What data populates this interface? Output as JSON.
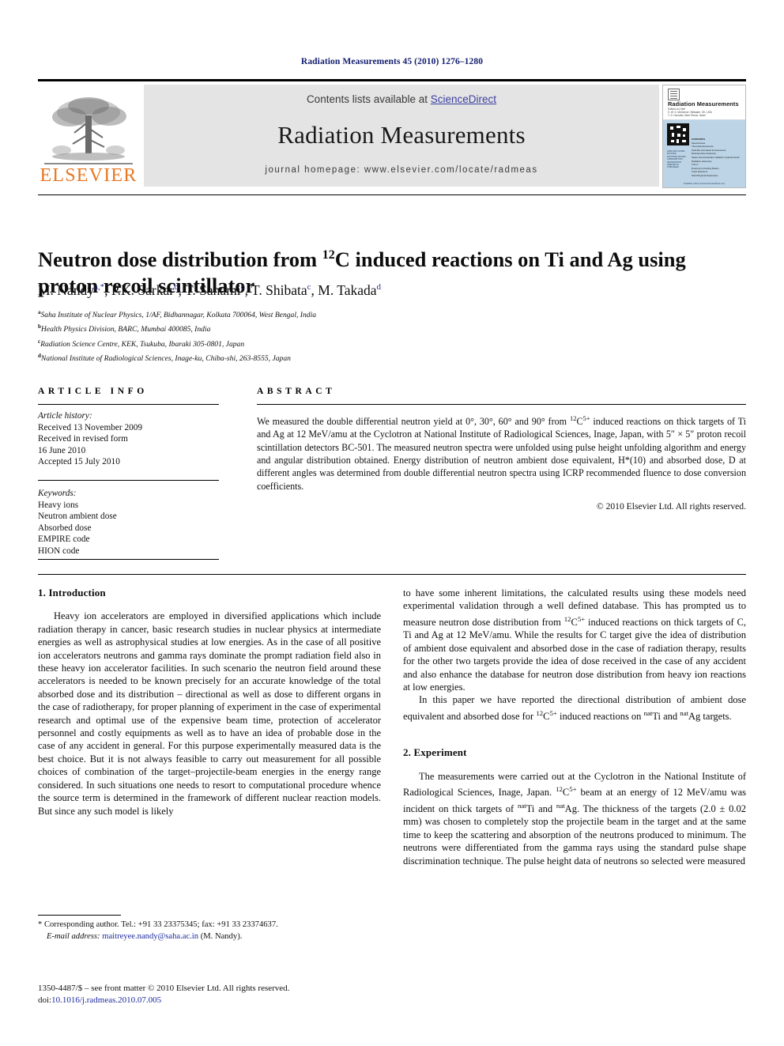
{
  "running_head": "Radiation Measurements 45 (2010) 1276–1280",
  "masthead": {
    "contents_prefix": "Contents lists available at ",
    "sciencedirect": "ScienceDirect",
    "journal_name": "Radiation Measurements",
    "homepage": "journal homepage: www.elsevier.com/locate/radmeas",
    "publisher_wordmark": "ELSEVIER",
    "sciencedirect_color": "#3b3fa0",
    "elsevier_orange": "#e87722",
    "band_color": "#e4e4e4"
  },
  "cover": {
    "title": "Radiation Measurements",
    "subtitle": "Editors-in-Chief\nS. W. S. McKeever, Stillwater, OK, USA\nY. S. Horowitz, Beer Sheva, Israel",
    "left_column": "AIMS AND SCOPE\nEDITORS\nEDITORIAL BOARD\nSUBSCRIPTION\nINFORMATION\nINDEXED IN\nPUBLISHER",
    "toc_heading": "CONTENTS",
    "toc_items": [
      "Special Issue",
      "Thermoluminescence",
      "Optically stimulated luminescence",
      "Retrospective dosimetry",
      "Space and accelerator radiation measurements",
      "Radiation dosimetry",
      "TLD in",
      "Dosimetry including Radon",
      "Track Detectors",
      "Solid Physical Dosimeters"
    ],
    "footer": "Available online at www.sciencedirect.com"
  },
  "article": {
    "title_part1": "Neutron dose distribution from ",
    "title_sup": "12",
    "title_part2": "C induced reactions on Ti and Ag using proton recoil scintillator",
    "authors": [
      {
        "name": "M. Nandy",
        "marks": "a,*"
      },
      {
        "name": "P.K. Sarkar",
        "marks": "b"
      },
      {
        "name": "T. Sanami",
        "marks": "c"
      },
      {
        "name": "T. Shibata",
        "marks": "c"
      },
      {
        "name": "M. Takada",
        "marks": "d"
      }
    ],
    "affiliations": [
      {
        "mark": "a",
        "text": "Saha Institute of Nuclear Physics, 1/AF, Bidhannagar, Kolkata 700064, West Bengal, India"
      },
      {
        "mark": "b",
        "text": "Health Physics Division, BARC, Mumbai 400085, India"
      },
      {
        "mark": "c",
        "text": "Radiation Science Centre, KEK, Tsukuba, Ibaraki 305-0801, Japan"
      },
      {
        "mark": "d",
        "text": "National Institute of Radiological Sciences, Inage-ku, Chiba-shi, 263-8555, Japan"
      }
    ]
  },
  "article_info": {
    "heading": "ARTICLE INFO",
    "history_label": "Article history:",
    "history_lines": [
      "Received 13 November 2009",
      "Received in revised form",
      "16 June 2010",
      "Accepted 15 July 2010"
    ],
    "keywords_label": "Keywords:",
    "keywords": [
      "Heavy ions",
      "Neutron ambient dose",
      "Absorbed dose",
      "EMPIRE code",
      "HION code"
    ]
  },
  "abstract": {
    "heading": "ABSTRACT",
    "text": "We measured the double differential neutron yield at 0°, 30°, 60° and 90° from 12C5+ induced reactions on thick targets of Ti and Ag at 12 MeV/amu at the Cyclotron at National Institute of Radiological Sciences, Inage, Japan, with 5″ × 5″ proton recoil scintillation detectors BC-501. The measured neutron spectra were unfolded using pulse height unfolding algorithm and energy and angular distribution obtained. Energy distribution of neutron ambient dose equivalent, H*(10) and absorbed dose, D at different angles was determined from double differential neutron spectra using ICRP recommended fluence to dose conversion coefficients.",
    "copyright": "© 2010 Elsevier Ltd. All rights reserved."
  },
  "body": {
    "section1_heading": "1. Introduction",
    "section1_p1": "Heavy ion accelerators are employed in diversified applications which include radiation therapy in cancer, basic research studies in nuclear physics at intermediate energies as well as astrophysical studies at low energies. As in the case of all positive ion accelerators neutrons and gamma rays dominate the prompt radiation field also in these heavy ion accelerator facilities. In such scenario the neutron field around these accelerators is needed to be known precisely for an accurate knowledge of the total absorbed dose and its distribution – directional as well as dose to different organs in the case of radiotherapy, for proper planning of experiment in the case of experimental research and optimal use of the expensive beam time, protection of accelerator personnel and costly equipments as well as to have an idea of probable dose in the case of any accident in general. For this purpose experimentally measured data is the best choice. But it is not always feasible to carry out measurement for all possible choices of combination of the target–projectile-beam energies in the energy range considered. In such situations one needs to resort to computational procedure whence the source term is determined in the framework of different nuclear reaction models. But since any such model is likely to have some inherent limitations, the calculated results using these models need experimental validation through a well defined database. This has prompted us to measure neutron dose distribution from 12C5+ induced reactions on thick targets of C, Ti and Ag at 12 MeV/amu. While the results for C target give the idea of distribution of ambient dose equivalent and absorbed dose in the case of radiation therapy, results for the other two targets provide the idea of dose received in the case of any accident and also enhance the database for neutron dose distribution from heavy ion reactions at low energies.",
    "section1_p2": "In this paper we have reported the directional distribution of ambient dose equivalent and absorbed dose for 12C5+ induced reactions on natTi and natAg targets.",
    "section2_heading": "2. Experiment",
    "section2_p1": "The measurements were carried out at the Cyclotron in the National Institute of Radiological Sciences, Inage, Japan. 12C5+ beam at an energy of 12 MeV/amu was incident on thick targets of natTi and natAg. The thickness of the targets (2.0 ± 0.02 mm) was chosen to completely stop the projectile beam in the target and at the same time to keep the scattering and absorption of the neutrons produced to minimum. The neutrons were differentiated from the gamma rays using the standard pulse shape discrimination technique. The pulse height data of neutrons so selected were measured"
  },
  "footnotes": {
    "corresponding": "* Corresponding author. Tel.: +91 33 23375345; fax: +91 33 23374637.",
    "email_label": "E-mail address:",
    "email": "maitreyee.nandy@saha.ac.in",
    "email_suffix": " (M. Nandy)."
  },
  "imprint": {
    "line1": "1350-4487/$ – see front matter © 2010 Elsevier Ltd. All rights reserved.",
    "doi_label": "doi:",
    "doi": "10.1016/j.radmeas.2010.07.005"
  }
}
